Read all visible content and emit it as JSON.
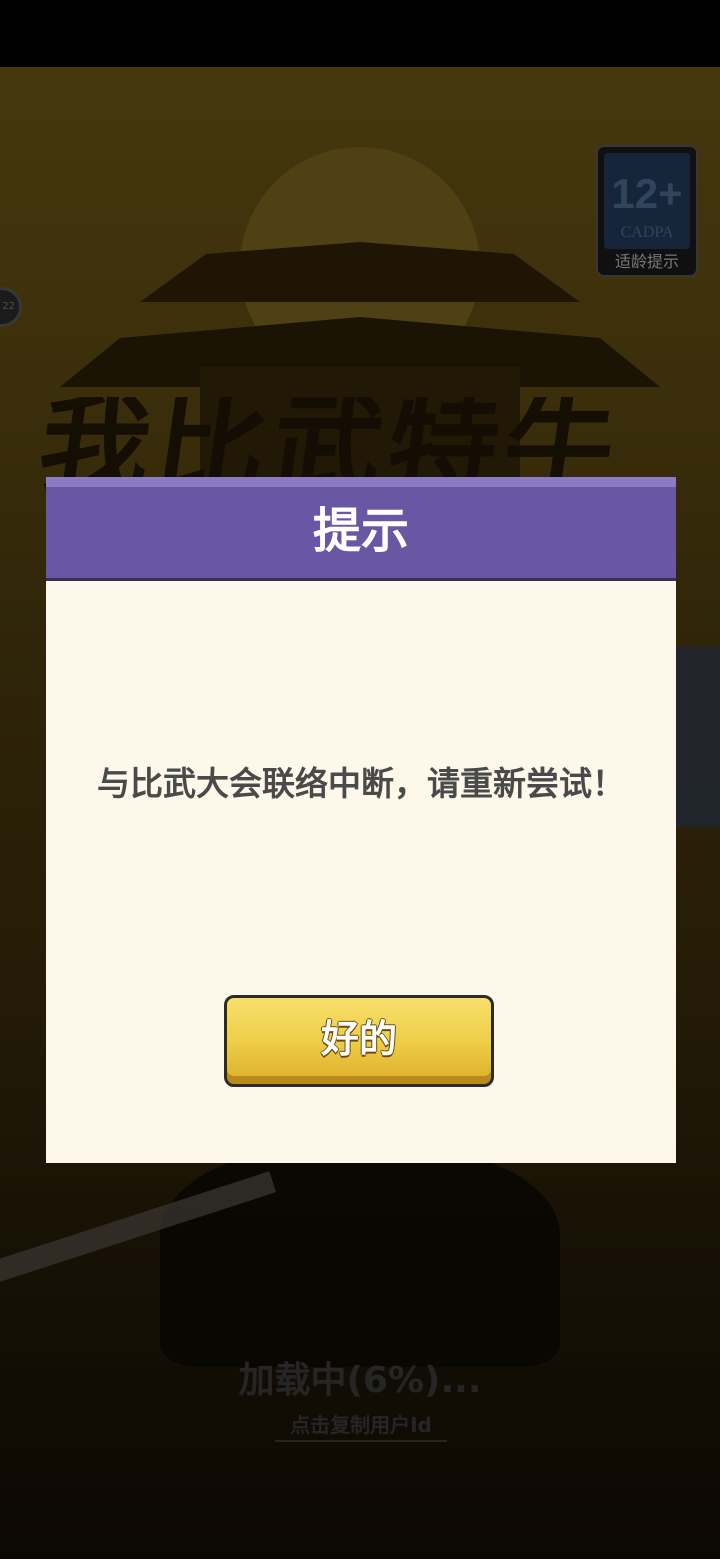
{
  "background": {
    "title_art": "我比武特牛"
  },
  "age_rating": {
    "number": "12+",
    "org": "CADPA",
    "label": "适龄提示"
  },
  "side_badge": {
    "text": "22"
  },
  "loading": {
    "status_text": "加载中(6%)...",
    "progress_percent": 6,
    "copy_user_id_link": "点击复制用户Id"
  },
  "dialog": {
    "title": "提示",
    "message": "与比武大会联络中断，请重新尝试！",
    "ok_button_label": "好的"
  },
  "colors": {
    "dialog_header": "#6a57a3",
    "dialog_body": "#fdf8ea",
    "ok_button": "#efce48"
  }
}
